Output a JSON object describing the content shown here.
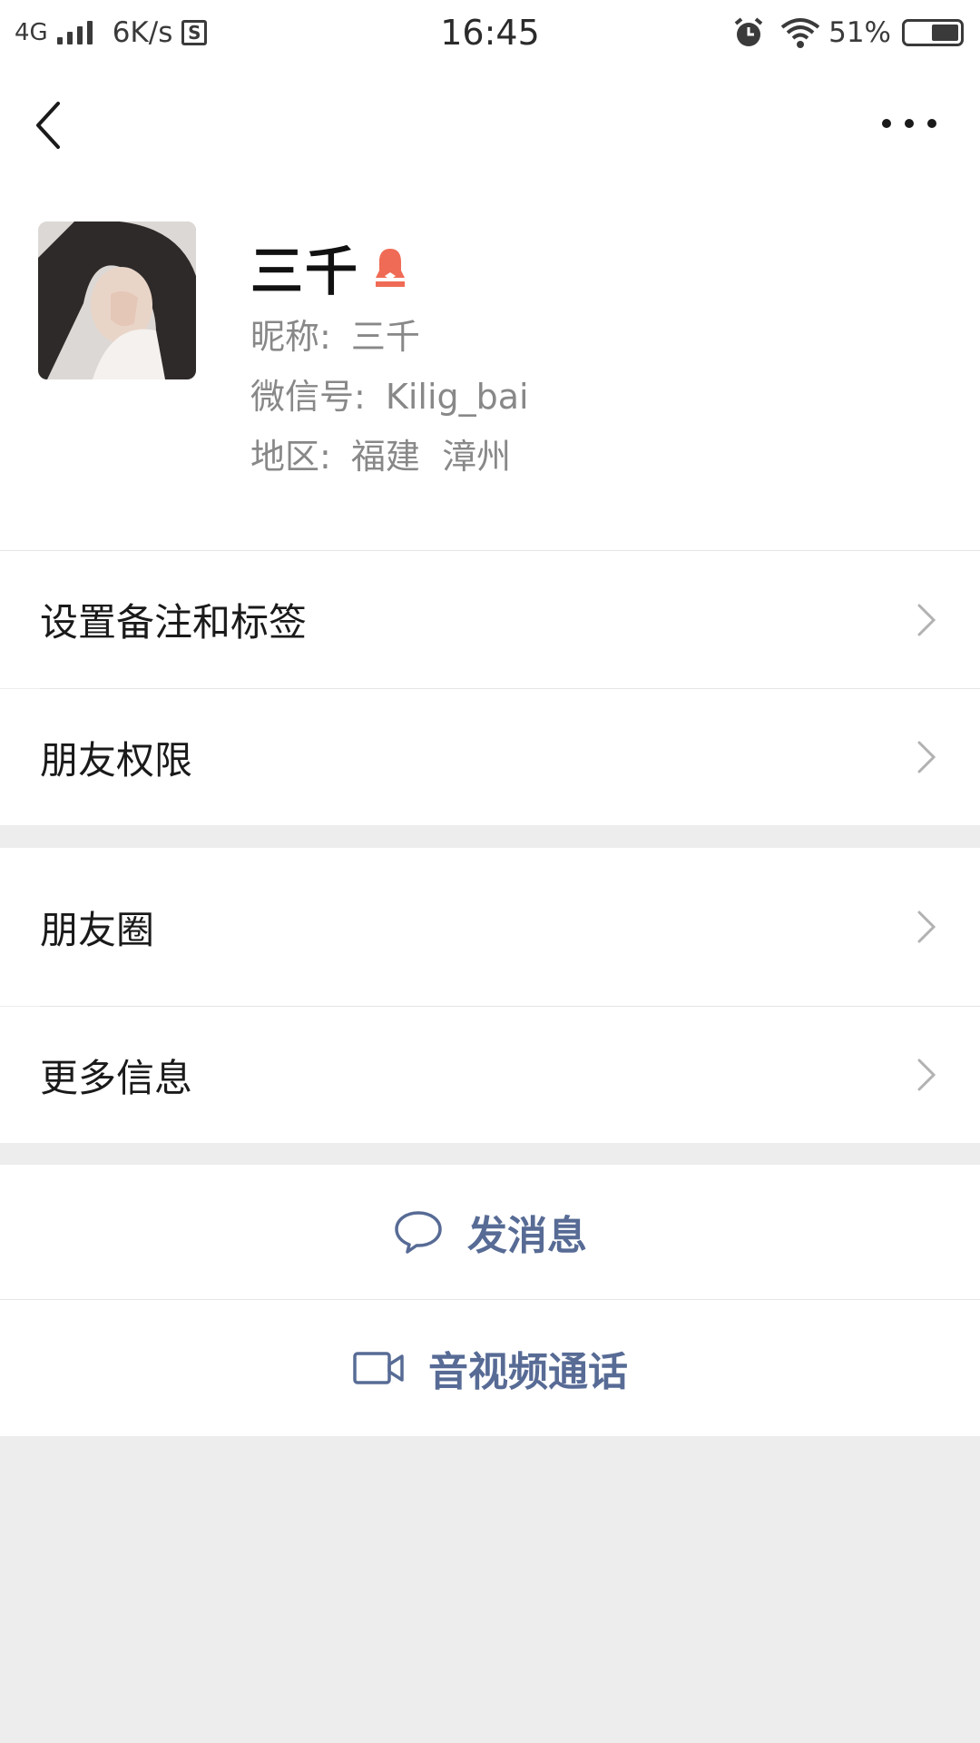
{
  "status_bar": {
    "network": "4G",
    "speed": "6K/s",
    "s_icon": "S",
    "time": "16:45",
    "battery": "51%",
    "battery_level": 0.51,
    "icons": [
      "signal-icon",
      "sim-s-icon",
      "alarm-icon",
      "wifi-icon",
      "battery-icon"
    ]
  },
  "header": {
    "back_icon": "chevron-left-icon",
    "more_icon": "more-dots-icon"
  },
  "profile": {
    "name": "三千",
    "gender_icon": "female-icon",
    "gender_color": "#f06b55",
    "nickname_label": "昵称:",
    "nickname": "三千",
    "wechat_id_label": "微信号:",
    "wechat_id": "Kilig_bai",
    "region_label": "地区:",
    "region": "福建  漳州"
  },
  "menu": {
    "group1": [
      {
        "label": "设置备注和标签"
      },
      {
        "label": "朋友权限"
      }
    ],
    "group2": [
      {
        "label": "朋友圈"
      },
      {
        "label": "更多信息"
      }
    ]
  },
  "actions": {
    "message": "发消息",
    "call": "音视频通话",
    "accent": "#576b95"
  },
  "colors": {
    "background": "#ededed",
    "surface": "#ffffff",
    "secondary_text": "#888888"
  }
}
